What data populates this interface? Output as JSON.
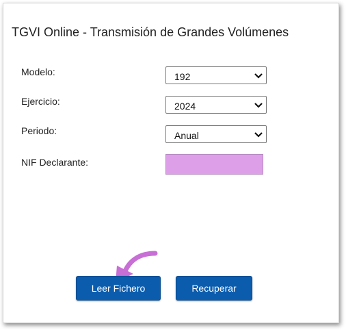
{
  "title": "TGVI Online - Transmisión de Grandes Volúmenes",
  "form": {
    "modelo": {
      "label": "Modelo:",
      "value": "192"
    },
    "ejercicio": {
      "label": "Ejercicio:",
      "value": "2024"
    },
    "periodo": {
      "label": "Periodo:",
      "value": "Anual"
    },
    "nif": {
      "label": "NIF Declarante:",
      "value": ""
    }
  },
  "buttons": {
    "leer": "Leer Fichero",
    "recuperar": "Recuperar"
  },
  "colors": {
    "button_bg": "#0b5cad",
    "nif_highlight": "#dda0e8",
    "arrow": "#c86fd6"
  },
  "icons": {
    "select_arrow": "chevron-down-icon",
    "pointer": "curved-arrow-icon"
  }
}
